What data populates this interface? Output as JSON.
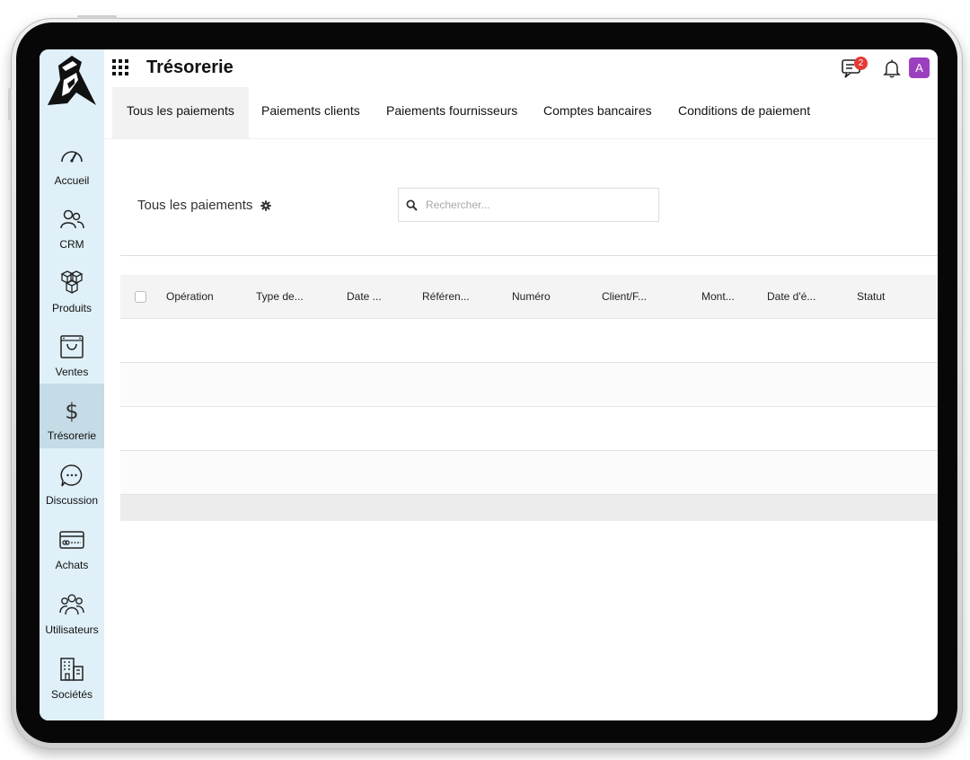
{
  "app": {
    "title": "Trésorerie",
    "notification_count": "2",
    "avatar_initial": "A"
  },
  "sidebar": {
    "items": [
      {
        "label": "Accueil",
        "icon": "speedometer-icon"
      },
      {
        "label": "CRM",
        "icon": "users-icon"
      },
      {
        "label": "Produits",
        "icon": "boxes-icon"
      },
      {
        "label": "Ventes",
        "icon": "shopping-bag-icon"
      },
      {
        "label": "Trésorerie",
        "icon": "dollar-icon"
      },
      {
        "label": "Discussion",
        "icon": "chat-bubble-icon"
      },
      {
        "label": "Achats",
        "icon": "credit-card-icon"
      },
      {
        "label": "Utilisateurs",
        "icon": "user-group-icon"
      },
      {
        "label": "Sociétés",
        "icon": "building-icon"
      }
    ],
    "active": "Trésorerie"
  },
  "tabs": [
    {
      "label": "Tous les paiements"
    },
    {
      "label": "Paiements clients"
    },
    {
      "label": "Paiements fournisseurs"
    },
    {
      "label": "Comptes bancaires"
    },
    {
      "label": "Conditions de paiement"
    }
  ],
  "active_tab": "Tous les paiements",
  "toolbar": {
    "view_title": "Tous les paiements",
    "search_placeholder": "Rechercher..."
  },
  "table": {
    "columns": [
      "Opération",
      "Type de...",
      "Date ...",
      "Référen...",
      "Numéro",
      "Client/F...",
      "Mont...",
      "Date d'é...",
      "Statut"
    ]
  },
  "colors": {
    "sidebar_bg": "#dff0f8",
    "sidebar_active": "#c5dbe6",
    "badge": "#e53935",
    "avatar": "#9c3fbf"
  }
}
